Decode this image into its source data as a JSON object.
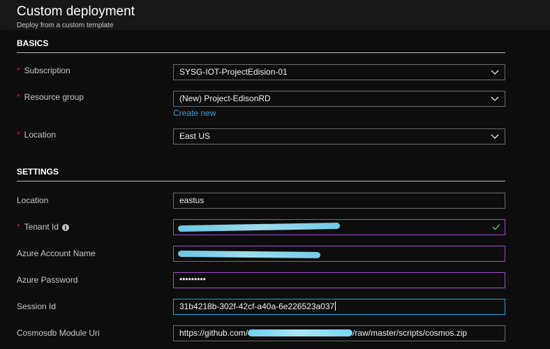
{
  "header": {
    "title": "Custom deployment",
    "subtitle": "Deploy from a custom template"
  },
  "basics": {
    "title": "BASICS",
    "subscription": {
      "label": "Subscription",
      "value": "SYSG-IOT-ProjectEdision-01"
    },
    "resource_group": {
      "label": "Resource group",
      "value": "(New) Project-EdisonRD",
      "create_new": "Create new"
    },
    "location": {
      "label": "Location",
      "value": "East US"
    }
  },
  "settings": {
    "title": "SETTINGS",
    "location": {
      "label": "Location",
      "value": "eastus"
    },
    "tenant_id": {
      "label": "Tenant Id"
    },
    "azure_account_name": {
      "label": "Azure Account Name"
    },
    "azure_password": {
      "label": "Azure Password",
      "value": "•••••••••"
    },
    "session_id": {
      "label": "Session Id",
      "value": "31b4218b-302f-42cf-a40a-6e226523a037"
    },
    "cosmosdb_module_uri": {
      "label": "Cosmosdb Module Uri",
      "value_prefix": "https://github.com/",
      "value_suffix": "/raw/master/scripts/cosmos.zip"
    }
  },
  "colors": {
    "required": "#e81123",
    "link": "#3a9de0",
    "valid_check": "#3fb950",
    "invalid_border": "#9b4dca",
    "focus_border": "#2aa0d8"
  },
  "icons": {
    "dropdown": "chevron-down-icon",
    "info": "info-icon",
    "valid": "checkmark-icon"
  }
}
